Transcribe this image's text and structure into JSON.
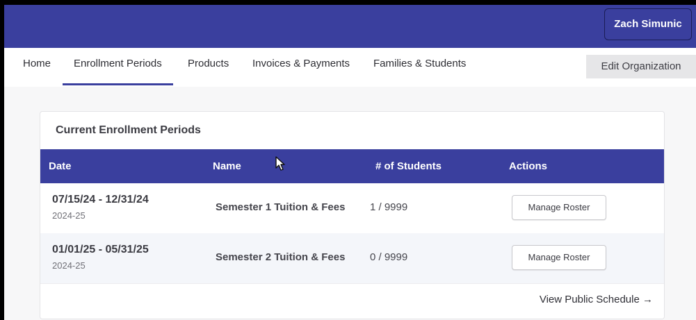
{
  "header": {
    "user_name": "Zach Simunic"
  },
  "nav": {
    "items": [
      {
        "label": "Home"
      },
      {
        "label": "Enrollment Periods"
      },
      {
        "label": "Products"
      },
      {
        "label": "Invoices & Payments"
      },
      {
        "label": "Families & Students"
      }
    ],
    "active": "Enrollment Periods",
    "edit_org_label": "Edit Organization"
  },
  "card": {
    "title": "Current Enrollment Periods",
    "columns": [
      "Date",
      "Name",
      "# of Students",
      "Actions"
    ],
    "rows": [
      {
        "date": "07/15/24 - 12/31/24",
        "year": "2024-25",
        "name": "Semester 1 Tuition & Fees",
        "students": "1 / 9999",
        "action": "Manage Roster"
      },
      {
        "date": "01/01/25 - 05/31/25",
        "year": "2024-25",
        "name": "Semester 2 Tuition & Fees",
        "students": "0 / 9999",
        "action": "Manage Roster"
      }
    ],
    "footer_link": "View Public Schedule →"
  },
  "colors": {
    "brand": "#3a3f9e",
    "page_bg": "#f7f7f8"
  },
  "icons": {
    "cursor": "mouse-pointer-icon"
  }
}
